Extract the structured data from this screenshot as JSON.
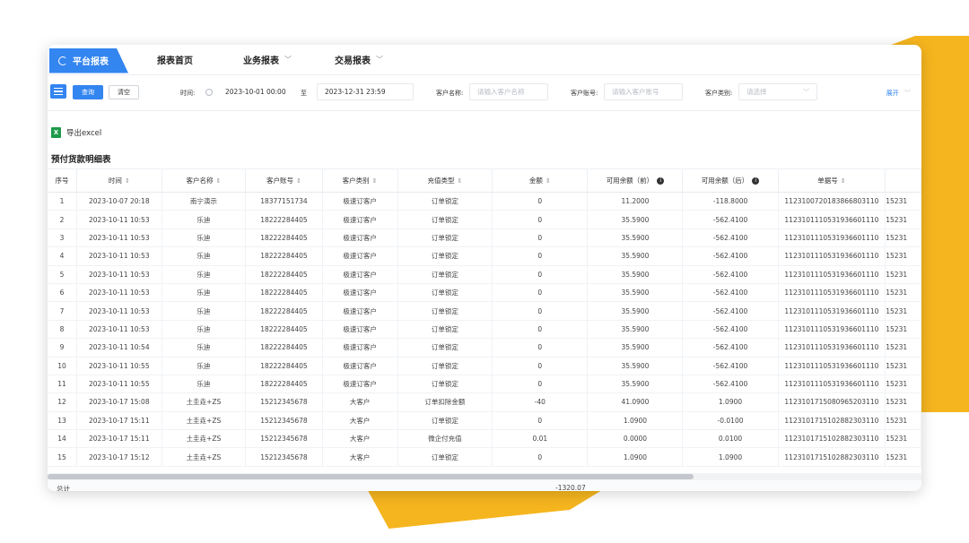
{
  "nav": {
    "active": "平台报表",
    "items": [
      {
        "label": "报表首页",
        "chevron": false
      },
      {
        "label": "业务报表",
        "chevron": true
      },
      {
        "label": "交易报表",
        "chevron": true
      }
    ]
  },
  "filters": {
    "query_label": "查询",
    "clear_label": "清空",
    "time_label": "时间:",
    "time_start": "2023-10-01 00:00",
    "time_to": "至",
    "time_end": "2023-12-31 23:59",
    "customer_name_label": "客户名称:",
    "customer_name_placeholder": "请输入客户名称",
    "customer_account_label": "客户账号:",
    "customer_account_placeholder": "请输入客户账号",
    "customer_type_label": "客户类别:",
    "customer_type_placeholder": "请选择",
    "expand_label": "展开"
  },
  "export_label": "导出excel",
  "section_title": "预付货款明细表",
  "table": {
    "columns": [
      {
        "label": "序号",
        "sort": false,
        "info": false
      },
      {
        "label": "时间",
        "sort": true,
        "info": false
      },
      {
        "label": "客户名称",
        "sort": true,
        "info": false
      },
      {
        "label": "客户账号",
        "sort": true,
        "info": false
      },
      {
        "label": "客户类别",
        "sort": true,
        "info": false
      },
      {
        "label": "充值类型",
        "sort": true,
        "info": false
      },
      {
        "label": "金额",
        "sort": true,
        "info": false
      },
      {
        "label": "可用余额（前）",
        "sort": false,
        "info": true
      },
      {
        "label": "可用余额（后）",
        "sort": false,
        "info": true
      },
      {
        "label": "单据号",
        "sort": true,
        "info": false
      },
      {
        "label": "",
        "sort": false,
        "info": false
      }
    ],
    "rows": [
      [
        "1",
        "2023-10-07 20:18",
        "南宁演示",
        "18377151734",
        "极速订客户",
        "订单锁定",
        "0",
        "11.2000",
        "-118.8000",
        "1123100720183866803110",
        "15231"
      ],
      [
        "2",
        "2023-10-11 10:53",
        "乐迪",
        "18222284405",
        "极速订客户",
        "订单锁定",
        "0",
        "35.5900",
        "-562.4100",
        "1123101110531936601110",
        "15231"
      ],
      [
        "3",
        "2023-10-11 10:53",
        "乐迪",
        "18222284405",
        "极速订客户",
        "订单锁定",
        "0",
        "35.5900",
        "-562.4100",
        "1123101110531936601110",
        "15231"
      ],
      [
        "4",
        "2023-10-11 10:53",
        "乐迪",
        "18222284405",
        "极速订客户",
        "订单锁定",
        "0",
        "35.5900",
        "-562.4100",
        "1123101110531936601110",
        "15231"
      ],
      [
        "5",
        "2023-10-11 10:53",
        "乐迪",
        "18222284405",
        "极速订客户",
        "订单锁定",
        "0",
        "35.5900",
        "-562.4100",
        "1123101110531936601110",
        "15231"
      ],
      [
        "6",
        "2023-10-11 10:53",
        "乐迪",
        "18222284405",
        "极速订客户",
        "订单锁定",
        "0",
        "35.5900",
        "-562.4100",
        "1123101110531936601110",
        "15231"
      ],
      [
        "7",
        "2023-10-11 10:53",
        "乐迪",
        "18222284405",
        "极速订客户",
        "订单锁定",
        "0",
        "35.5900",
        "-562.4100",
        "1123101110531936601110",
        "15231"
      ],
      [
        "8",
        "2023-10-11 10:53",
        "乐迪",
        "18222284405",
        "极速订客户",
        "订单锁定",
        "0",
        "35.5900",
        "-562.4100",
        "1123101110531936601110",
        "15231"
      ],
      [
        "9",
        "2023-10-11 10:54",
        "乐迪",
        "18222284405",
        "极速订客户",
        "订单锁定",
        "0",
        "35.5900",
        "-562.4100",
        "1123101110531936601110",
        "15231"
      ],
      [
        "10",
        "2023-10-11 10:55",
        "乐迪",
        "18222284405",
        "极速订客户",
        "订单锁定",
        "0",
        "35.5900",
        "-562.4100",
        "1123101110531936601110",
        "15231"
      ],
      [
        "11",
        "2023-10-11 10:55",
        "乐迪",
        "18222284405",
        "极速订客户",
        "订单锁定",
        "0",
        "35.5900",
        "-562.4100",
        "1123101110531936601110",
        "15231"
      ],
      [
        "12",
        "2023-10-17 15:08",
        "土圭垚+ZS",
        "15212345678",
        "大客户",
        "订单扣除金额",
        "-40",
        "41.0900",
        "1.0900",
        "1123101715080965203110",
        "15231"
      ],
      [
        "13",
        "2023-10-17 15:11",
        "土圭垚+ZS",
        "15212345678",
        "大客户",
        "订单锁定",
        "0",
        "1.0900",
        "-0.0100",
        "1123101715102882303110",
        "15231"
      ],
      [
        "14",
        "2023-10-17 15:11",
        "土圭垚+ZS",
        "15212345678",
        "大客户",
        "微企付充值",
        "0.01",
        "0.0000",
        "0.0100",
        "1123101715102882303110",
        "15231"
      ],
      [
        "15",
        "2023-10-17 15:12",
        "土圭垚+ZS",
        "15212345678",
        "大客户",
        "订单锁定",
        "0",
        "1.0900",
        "1.0900",
        "1123101715102882303110",
        "15231"
      ]
    ]
  },
  "total": {
    "label": "总计",
    "amount": "-1320.07"
  },
  "colors": {
    "accent": "#3385f0",
    "decoration": "#f5b51e",
    "excel": "#1f9a4a"
  },
  "icons": {
    "nav": "pie-chart-icon",
    "menu": "menu-icon",
    "clock": "clock-icon",
    "excel": "excel-icon",
    "sort": "sort-icon",
    "info": "info-icon",
    "chevron": "chevron-down-icon"
  }
}
